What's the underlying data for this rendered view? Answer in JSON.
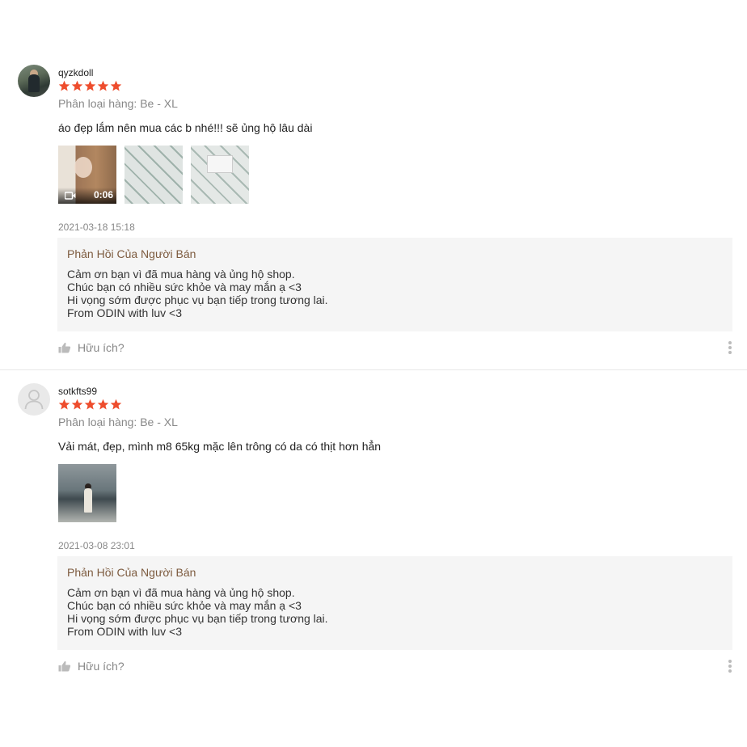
{
  "colors": {
    "star": "#ee4d2d",
    "reply_title": "#7d5b3f",
    "muted": "#888888"
  },
  "reviews": [
    {
      "username": "qyzkdoll",
      "rating": 5,
      "variation": "Phân loại hàng: Be - XL",
      "comment": "áo đẹp lắm nên mua các b nhé!!! sẽ ủng hộ lâu dài",
      "video_duration": "0:06",
      "timestamp": "2021-03-18 15:18",
      "reply": {
        "title": "Phản Hồi Của Người Bán",
        "lines": [
          "Cảm ơn bạn vì đã mua hàng và ủng hộ shop.",
          "Chúc bạn có nhiều sức khỏe và may mắn ạ <3",
          "Hi vọng sớm được phục vụ bạn tiếp trong tương lai.",
          "From ODIN with luv <3"
        ]
      },
      "helpful_label": "Hữu ích?"
    },
    {
      "username": "sotkfts99",
      "rating": 5,
      "variation": "Phân loại hàng: Be - XL",
      "comment": "Vải mát, đẹp, mình m8 65kg mặc lên trông có da có thịt hơn hẳn",
      "timestamp": "2021-03-08 23:01",
      "reply": {
        "title": "Phản Hồi Của Người Bán",
        "lines": [
          "Cảm ơn bạn vì đã mua hàng và ủng hộ shop.",
          "Chúc bạn có nhiều sức khỏe và may mắn ạ <3",
          "Hi vọng sớm được phục vụ bạn tiếp trong tương lai.",
          "From ODIN with luv <3"
        ]
      },
      "helpful_label": "Hữu ích?"
    }
  ]
}
